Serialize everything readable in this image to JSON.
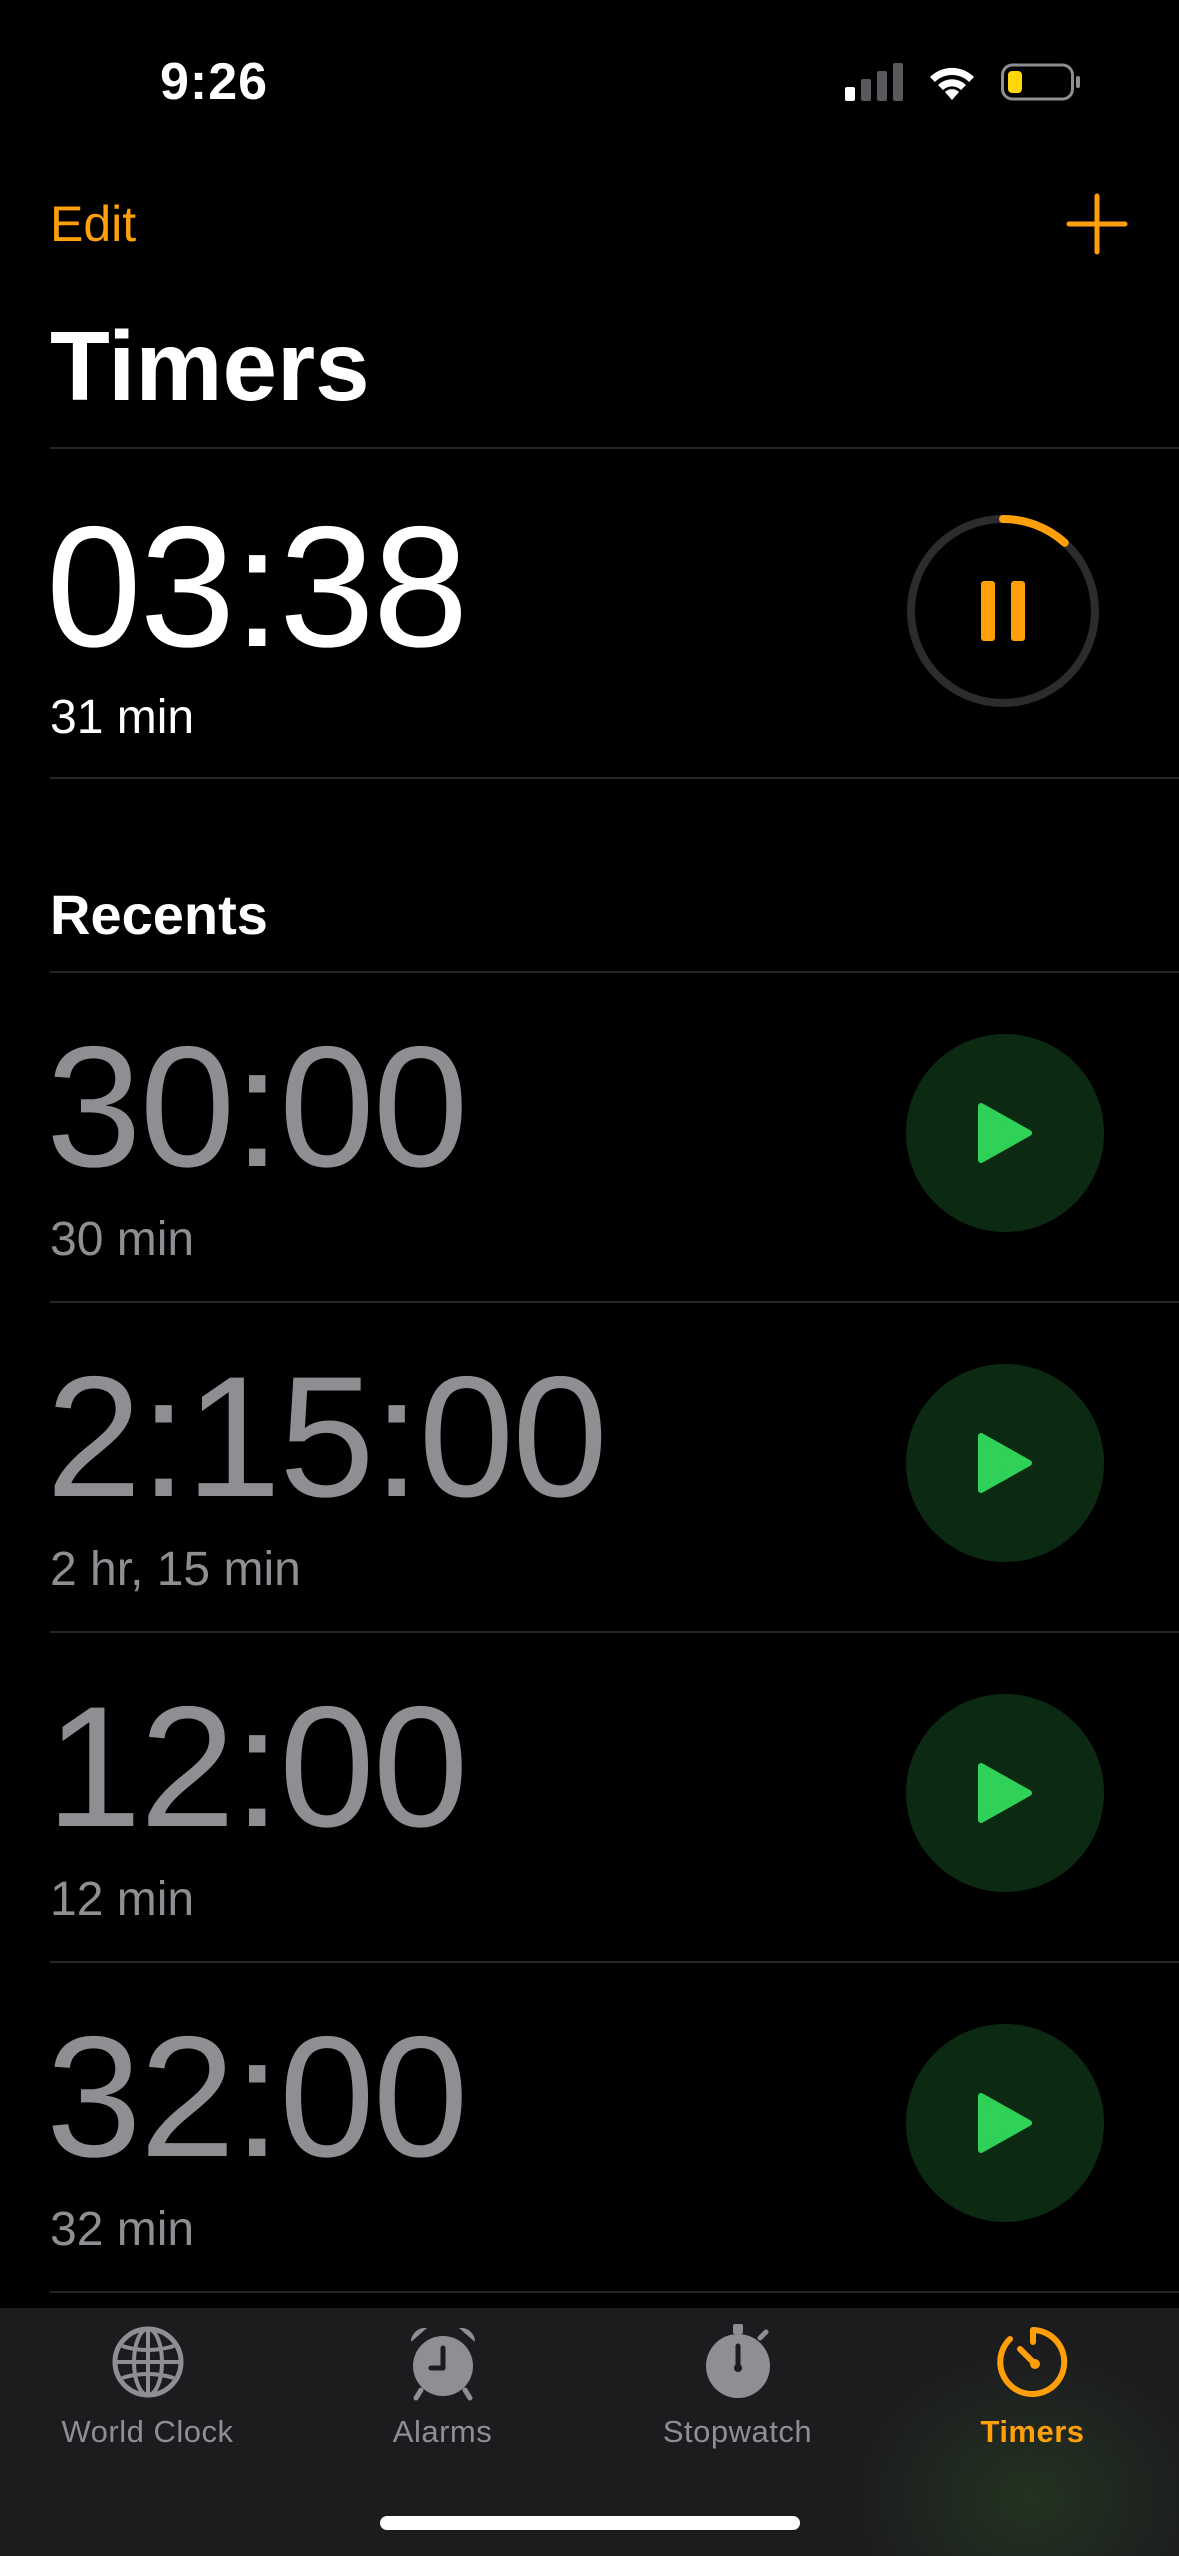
{
  "status_bar": {
    "time": "9:26"
  },
  "nav": {
    "edit_label": "Edit",
    "title": "Timers"
  },
  "active_timer": {
    "remaining": "03:38",
    "label": "31 min",
    "progress_fraction": 0.117,
    "accent": "#ff9f0a",
    "icon": "pause-icon"
  },
  "recents": {
    "title": "Recents",
    "items": [
      {
        "time": "30:00",
        "label": "30 min"
      },
      {
        "time": "2:15:00",
        "label": "2 hr, 15 min"
      },
      {
        "time": "12:00",
        "label": "12 min"
      },
      {
        "time": "32:00",
        "label": "32 min"
      }
    ],
    "play_color": "#30d158"
  },
  "tab_bar": {
    "tabs": [
      {
        "label": "World Clock",
        "icon": "globe-icon",
        "active": false
      },
      {
        "label": "Alarms",
        "icon": "alarm-clock-icon",
        "active": false
      },
      {
        "label": "Stopwatch",
        "icon": "stopwatch-icon",
        "active": false
      },
      {
        "label": "Timers",
        "icon": "timer-icon",
        "active": true
      }
    ]
  },
  "colors": {
    "background": "#000000",
    "accent": "#ff9f0a",
    "secondary_text": "#8e8e93",
    "play_button_bg": "#0c2a12"
  }
}
